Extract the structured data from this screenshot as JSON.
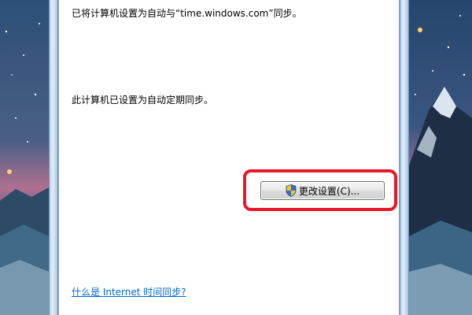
{
  "dialog": {
    "sync_message": "已将计算机设置为自动与“time.windows.com”同步。",
    "auto_message": "此计算机已设置为自动定期同步。",
    "change_button_label": "更改设置(C)...",
    "help_link": "什么是 Internet 时间同步?"
  },
  "icons": {
    "button_icon": "uac-shield-icon"
  },
  "colors": {
    "highlight": "#e8182a",
    "link": "#0066cc",
    "frame": "#c7dbf0"
  }
}
